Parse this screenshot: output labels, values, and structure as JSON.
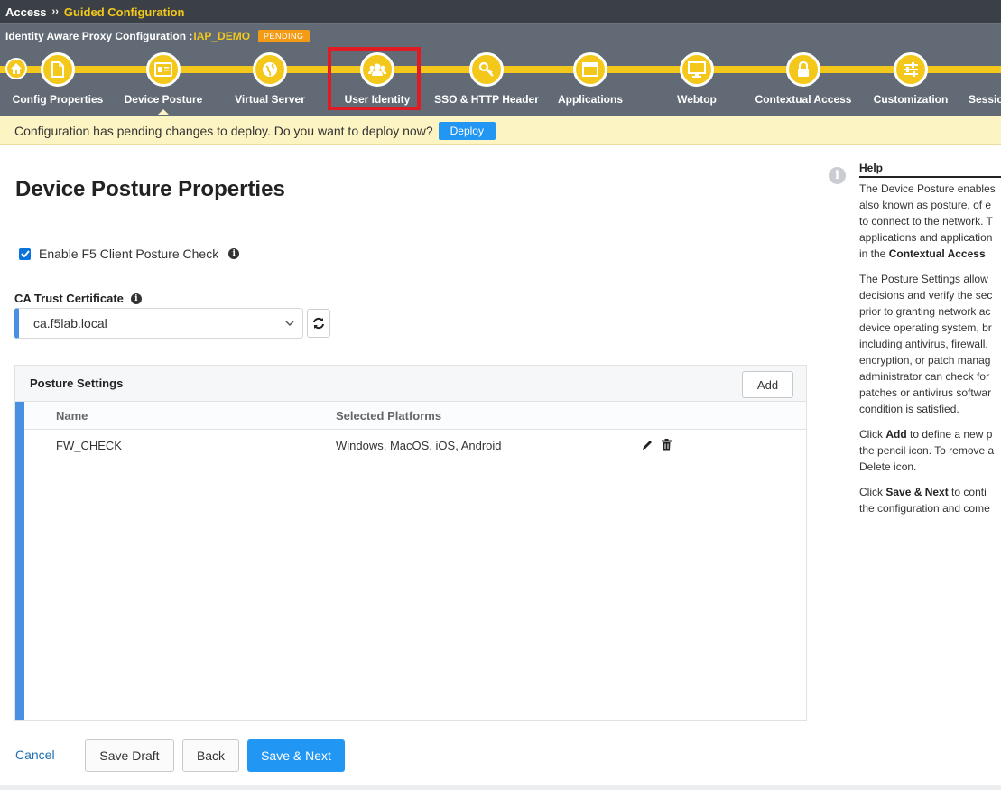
{
  "breadcrumb": {
    "root": "Access",
    "separator": "››",
    "current": "Guided Configuration"
  },
  "header": {
    "title_prefix": "Identity Aware Proxy Configuration :",
    "config_name": "IAP_DEMO",
    "status_badge": "PENDING"
  },
  "steps": [
    {
      "label": "Config Properties",
      "icon": "document-icon",
      "active": false
    },
    {
      "label": "Device Posture",
      "icon": "id-card-icon",
      "active": true
    },
    {
      "label": "Virtual Server",
      "icon": "globe-icon",
      "active": false
    },
    {
      "label": "User Identity",
      "icon": "users-icon",
      "active": false,
      "highlighted": true
    },
    {
      "label": "SSO & HTTP Header",
      "icon": "key-icon",
      "active": false
    },
    {
      "label": "Applications",
      "icon": "window-icon",
      "active": false
    },
    {
      "label": "Webtop",
      "icon": "monitor-icon",
      "active": false
    },
    {
      "label": "Contextual Access",
      "icon": "lock-icon",
      "active": false
    },
    {
      "label": "Customization",
      "icon": "sliders-icon",
      "active": false
    },
    {
      "label": "Sessio",
      "icon": "",
      "active": false
    }
  ],
  "banner": {
    "message": "Configuration has pending changes to deploy. Do you want to deploy now?",
    "deploy_label": "Deploy"
  },
  "page": {
    "title": "Device Posture Properties",
    "enable_checkbox_label": "Enable F5 Client Posture Check",
    "enable_checked": true,
    "ca_label": "CA Trust Certificate",
    "ca_value": "ca.f5lab.local"
  },
  "posture": {
    "title": "Posture Settings",
    "add_label": "Add",
    "columns": [
      "Name",
      "Selected Platforms"
    ],
    "rows": [
      {
        "name": "FW_CHECK",
        "platforms": "Windows, MacOS, iOS, Android"
      }
    ]
  },
  "footer": {
    "cancel": "Cancel",
    "save_draft": "Save Draft",
    "back": "Back",
    "save_next": "Save & Next"
  },
  "help": {
    "heading": "Help",
    "p1": [
      "The Device Posture enables",
      "also known as posture, of e",
      "to connect to the network. T",
      "applications and application"
    ],
    "p1_last_prefix": "in the ",
    "p1_last_bold": "Contextual Access",
    "p2": [
      "The Posture Settings allow",
      "decisions and verify the sec",
      "prior to granting network ac",
      "device operating system, br",
      "including antivirus, firewall,",
      "encryption, or patch manag",
      "administrator can check for",
      "patches or antivirus softwar",
      "condition is satisfied."
    ],
    "p3_prefix": "Click ",
    "p3_bold": "Add",
    "p3_suffix": " to define a new p",
    "p3_rest": [
      "the pencil icon. To remove a",
      "Delete icon."
    ],
    "p4_prefix": "Click ",
    "p4_bold": "Save & Next",
    "p4_suffix": " to conti",
    "p4_rest": [
      "the configuration and come"
    ]
  },
  "colors": {
    "accent_yellow": "#f4c81b",
    "header_gray": "#626b75",
    "primary_blue": "#2196f3",
    "highlight_red": "#e01b24"
  }
}
